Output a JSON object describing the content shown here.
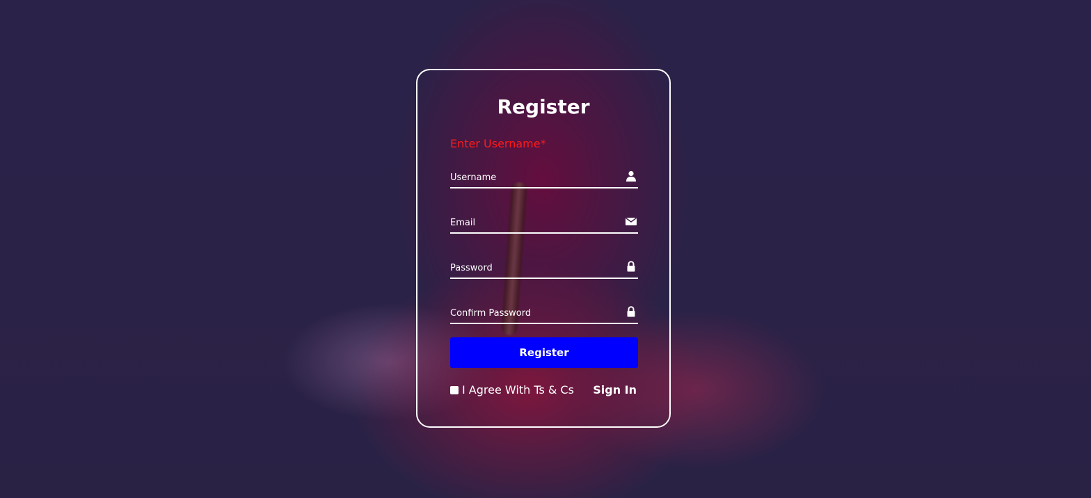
{
  "form": {
    "title": "Register",
    "error_message": "Enter Username*",
    "fields": [
      {
        "placeholder": "Username",
        "value": "",
        "icon": "user-icon"
      },
      {
        "placeholder": "Email",
        "value": "",
        "icon": "envelope-icon"
      },
      {
        "placeholder": "Password",
        "value": "",
        "icon": "lock-icon"
      },
      {
        "placeholder": "Confirm Password",
        "value": "",
        "icon": "lock-icon"
      }
    ],
    "submit_label": "Register",
    "agree_label": "I Agree With Ts & Cs",
    "agree_checked": false,
    "signin_label": "Sign In"
  },
  "colors": {
    "accent": "#0000ff",
    "error": "#ff1a1a",
    "text": "#ffffff"
  }
}
